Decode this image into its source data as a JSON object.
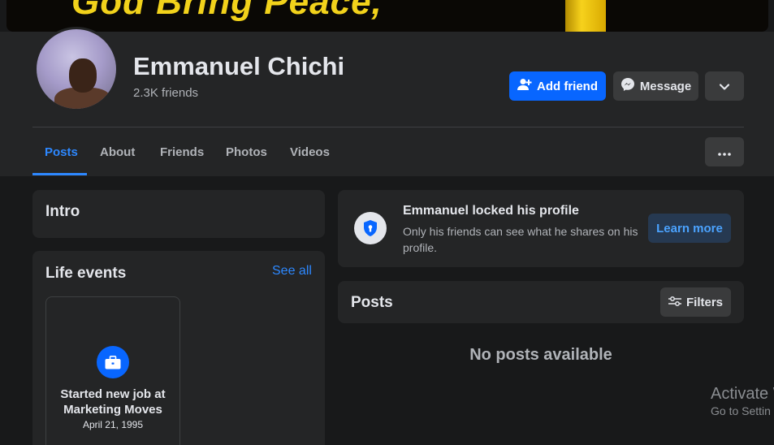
{
  "cover": {
    "text": "God Bring Peace,"
  },
  "profile": {
    "name": "Emmanuel Chichi",
    "friends_count": "2.3K friends"
  },
  "actions": {
    "add_friend": "Add friend",
    "message": "Message"
  },
  "tabs": [
    {
      "label": "Posts",
      "active": true
    },
    {
      "label": "About"
    },
    {
      "label": "Friends"
    },
    {
      "label": "Photos"
    },
    {
      "label": "Videos"
    }
  ],
  "intro": {
    "title": "Intro"
  },
  "life_events": {
    "title": "Life events",
    "see_all": "See all",
    "event": {
      "title": "Started new job at Marketing Moves",
      "date": "April 21, 1995"
    }
  },
  "locked": {
    "title": "Emmanuel locked his profile",
    "description": "Only his friends can see what he shares on his profile.",
    "learn_more": "Learn more"
  },
  "posts": {
    "title": "Posts",
    "filters": "Filters",
    "empty": "No posts available"
  },
  "watermark": {
    "line1": "Activate W",
    "line2": "Go to Settin"
  },
  "colors": {
    "accent": "#0866ff",
    "link": "#2d88ff",
    "background": "#18191a",
    "card": "#242526"
  }
}
